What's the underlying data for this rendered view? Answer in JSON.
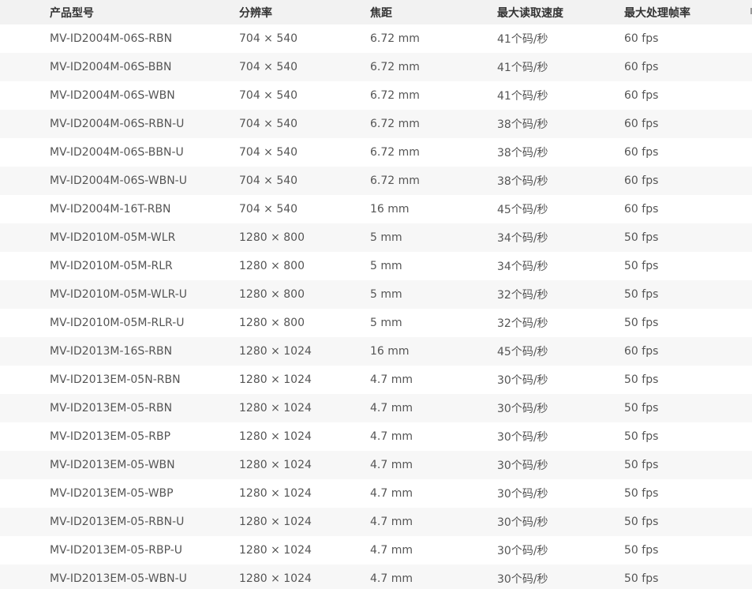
{
  "table": {
    "headers": [
      "产品型号",
      "分辨率",
      "焦距",
      "最大读取速度",
      "最大处理帧率"
    ],
    "rows": [
      [
        "MV-ID2004M-06S-RBN",
        "704 × 540",
        "6.72 mm",
        "41个码/秒",
        "60 fps"
      ],
      [
        "MV-ID2004M-06S-BBN",
        "704 × 540",
        "6.72 mm",
        "41个码/秒",
        "60 fps"
      ],
      [
        "MV-ID2004M-06S-WBN",
        "704 × 540",
        "6.72 mm",
        "41个码/秒",
        "60 fps"
      ],
      [
        "MV-ID2004M-06S-RBN-U",
        "704 × 540",
        "6.72 mm",
        "38个码/秒",
        "60 fps"
      ],
      [
        "MV-ID2004M-06S-BBN-U",
        "704 × 540",
        "6.72 mm",
        "38个码/秒",
        "60 fps"
      ],
      [
        "MV-ID2004M-06S-WBN-U",
        "704 × 540",
        "6.72 mm",
        "38个码/秒",
        "60 fps"
      ],
      [
        "MV-ID2004M-16T-RBN",
        "704 × 540",
        "16 mm",
        "45个码/秒",
        "60 fps"
      ],
      [
        "MV-ID2010M-05M-WLR",
        "1280 × 800",
        "5 mm",
        "34个码/秒",
        "50 fps"
      ],
      [
        "MV-ID2010M-05M-RLR",
        "1280 × 800",
        "5 mm",
        "34个码/秒",
        "50 fps"
      ],
      [
        "MV-ID2010M-05M-WLR-U",
        "1280 × 800",
        "5 mm",
        "32个码/秒",
        "50 fps"
      ],
      [
        "MV-ID2010M-05M-RLR-U",
        "1280 × 800",
        "5 mm",
        "32个码/秒",
        "50 fps"
      ],
      [
        "MV-ID2013M-16S-RBN",
        "1280 × 1024",
        "16 mm",
        "45个码/秒",
        "60 fps"
      ],
      [
        "MV-ID2013EM-05N-RBN",
        "1280 × 1024",
        "4.7 mm",
        "30个码/秒",
        "50 fps"
      ],
      [
        "MV-ID2013EM-05-RBN",
        "1280 × 1024",
        "4.7 mm",
        "30个码/秒",
        "50 fps"
      ],
      [
        "MV-ID2013EM-05-RBP",
        "1280 × 1024",
        "4.7 mm",
        "30个码/秒",
        "50 fps"
      ],
      [
        "MV-ID2013EM-05-WBN",
        "1280 × 1024",
        "4.7 mm",
        "30个码/秒",
        "50 fps"
      ],
      [
        "MV-ID2013EM-05-WBP",
        "1280 × 1024",
        "4.7 mm",
        "30个码/秒",
        "50 fps"
      ],
      [
        "MV-ID2013EM-05-RBN-U",
        "1280 × 1024",
        "4.7 mm",
        "30个码/秒",
        "50 fps"
      ],
      [
        "MV-ID2013EM-05-RBP-U",
        "1280 × 1024",
        "4.7 mm",
        "30个码/秒",
        "50 fps"
      ],
      [
        "MV-ID2013EM-05-WBN-U",
        "1280 × 1024",
        "4.7 mm",
        "30个码/秒",
        "50 fps"
      ]
    ]
  }
}
